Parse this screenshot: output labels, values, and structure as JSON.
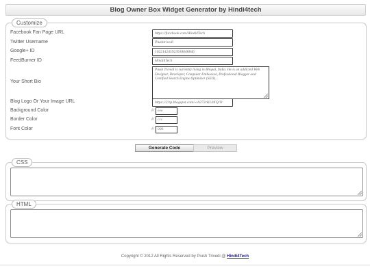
{
  "header": {
    "title": "Blog Owner Box Widget Generator by Hindi4tech"
  },
  "customize": {
    "legend": "Customize",
    "fields": [
      {
        "label": "Facebook Fan Page URL",
        "value": "https://facebook.com/Hindi4Tech"
      },
      {
        "label": "Twitter Username",
        "value": "Piushtrivedi"
      },
      {
        "label": "Google+ ID",
        "value": "102214245923918648846"
      },
      {
        "label": "FeedBurner ID",
        "value": "Hindi4Tech"
      }
    ],
    "bio": {
      "label": "Your Short Bio",
      "value": "Piush Trivedi is currently living in Bhopal, India. He is an addicted Web Designer, Developer, Computer Enthusiast, Professional Blogger and Certified Search Engine Optimizer (SEO)..."
    },
    "image": {
      "label": "Blog Logo Or Your Image URL",
      "value": "https://2.bp.blogspot.com/-cA272cKL0XQ/Tr"
    },
    "colors": [
      {
        "label": "Background Color",
        "hash": "#",
        "value": "eee"
      },
      {
        "label": "Border Color",
        "hash": "#",
        "value": "ccc"
      },
      {
        "label": "Font Color",
        "hash": "#",
        "value": "000"
      }
    ]
  },
  "buttons": {
    "generate": "Generate Code",
    "preview": "Preview"
  },
  "css_section": {
    "legend": "CSS"
  },
  "html_section": {
    "legend": "HTML"
  },
  "footer": {
    "text": "Copyright © 2012 All Rights Reserved by Piush Trivedi @",
    "link": "Hindi4Tech"
  }
}
